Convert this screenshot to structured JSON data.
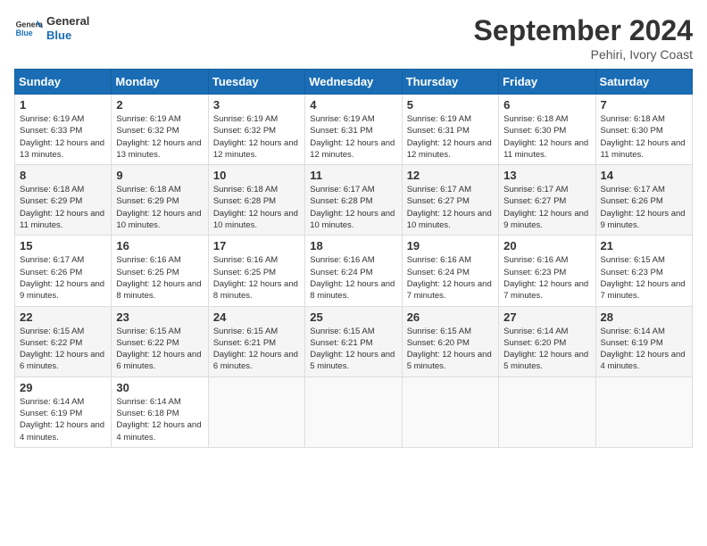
{
  "logo": {
    "text_general": "General",
    "text_blue": "Blue"
  },
  "title": "September 2024",
  "location": "Pehiri, Ivory Coast",
  "days_of_week": [
    "Sunday",
    "Monday",
    "Tuesday",
    "Wednesday",
    "Thursday",
    "Friday",
    "Saturday"
  ],
  "weeks": [
    [
      {
        "day": "1",
        "sunrise": "6:19 AM",
        "sunset": "6:33 PM",
        "daylight": "12 hours and 13 minutes."
      },
      {
        "day": "2",
        "sunrise": "6:19 AM",
        "sunset": "6:32 PM",
        "daylight": "12 hours and 13 minutes."
      },
      {
        "day": "3",
        "sunrise": "6:19 AM",
        "sunset": "6:32 PM",
        "daylight": "12 hours and 12 minutes."
      },
      {
        "day": "4",
        "sunrise": "6:19 AM",
        "sunset": "6:31 PM",
        "daylight": "12 hours and 12 minutes."
      },
      {
        "day": "5",
        "sunrise": "6:19 AM",
        "sunset": "6:31 PM",
        "daylight": "12 hours and 12 minutes."
      },
      {
        "day": "6",
        "sunrise": "6:18 AM",
        "sunset": "6:30 PM",
        "daylight": "12 hours and 11 minutes."
      },
      {
        "day": "7",
        "sunrise": "6:18 AM",
        "sunset": "6:30 PM",
        "daylight": "12 hours and 11 minutes."
      }
    ],
    [
      {
        "day": "8",
        "sunrise": "6:18 AM",
        "sunset": "6:29 PM",
        "daylight": "12 hours and 11 minutes."
      },
      {
        "day": "9",
        "sunrise": "6:18 AM",
        "sunset": "6:29 PM",
        "daylight": "12 hours and 10 minutes."
      },
      {
        "day": "10",
        "sunrise": "6:18 AM",
        "sunset": "6:28 PM",
        "daylight": "12 hours and 10 minutes."
      },
      {
        "day": "11",
        "sunrise": "6:17 AM",
        "sunset": "6:28 PM",
        "daylight": "12 hours and 10 minutes."
      },
      {
        "day": "12",
        "sunrise": "6:17 AM",
        "sunset": "6:27 PM",
        "daylight": "12 hours and 10 minutes."
      },
      {
        "day": "13",
        "sunrise": "6:17 AM",
        "sunset": "6:27 PM",
        "daylight": "12 hours and 9 minutes."
      },
      {
        "day": "14",
        "sunrise": "6:17 AM",
        "sunset": "6:26 PM",
        "daylight": "12 hours and 9 minutes."
      }
    ],
    [
      {
        "day": "15",
        "sunrise": "6:17 AM",
        "sunset": "6:26 PM",
        "daylight": "12 hours and 9 minutes."
      },
      {
        "day": "16",
        "sunrise": "6:16 AM",
        "sunset": "6:25 PM",
        "daylight": "12 hours and 8 minutes."
      },
      {
        "day": "17",
        "sunrise": "6:16 AM",
        "sunset": "6:25 PM",
        "daylight": "12 hours and 8 minutes."
      },
      {
        "day": "18",
        "sunrise": "6:16 AM",
        "sunset": "6:24 PM",
        "daylight": "12 hours and 8 minutes."
      },
      {
        "day": "19",
        "sunrise": "6:16 AM",
        "sunset": "6:24 PM",
        "daylight": "12 hours and 7 minutes."
      },
      {
        "day": "20",
        "sunrise": "6:16 AM",
        "sunset": "6:23 PM",
        "daylight": "12 hours and 7 minutes."
      },
      {
        "day": "21",
        "sunrise": "6:15 AM",
        "sunset": "6:23 PM",
        "daylight": "12 hours and 7 minutes."
      }
    ],
    [
      {
        "day": "22",
        "sunrise": "6:15 AM",
        "sunset": "6:22 PM",
        "daylight": "12 hours and 6 minutes."
      },
      {
        "day": "23",
        "sunrise": "6:15 AM",
        "sunset": "6:22 PM",
        "daylight": "12 hours and 6 minutes."
      },
      {
        "day": "24",
        "sunrise": "6:15 AM",
        "sunset": "6:21 PM",
        "daylight": "12 hours and 6 minutes."
      },
      {
        "day": "25",
        "sunrise": "6:15 AM",
        "sunset": "6:21 PM",
        "daylight": "12 hours and 5 minutes."
      },
      {
        "day": "26",
        "sunrise": "6:15 AM",
        "sunset": "6:20 PM",
        "daylight": "12 hours and 5 minutes."
      },
      {
        "day": "27",
        "sunrise": "6:14 AM",
        "sunset": "6:20 PM",
        "daylight": "12 hours and 5 minutes."
      },
      {
        "day": "28",
        "sunrise": "6:14 AM",
        "sunset": "6:19 PM",
        "daylight": "12 hours and 4 minutes."
      }
    ],
    [
      {
        "day": "29",
        "sunrise": "6:14 AM",
        "sunset": "6:19 PM",
        "daylight": "12 hours and 4 minutes."
      },
      {
        "day": "30",
        "sunrise": "6:14 AM",
        "sunset": "6:18 PM",
        "daylight": "12 hours and 4 minutes."
      },
      null,
      null,
      null,
      null,
      null
    ]
  ]
}
